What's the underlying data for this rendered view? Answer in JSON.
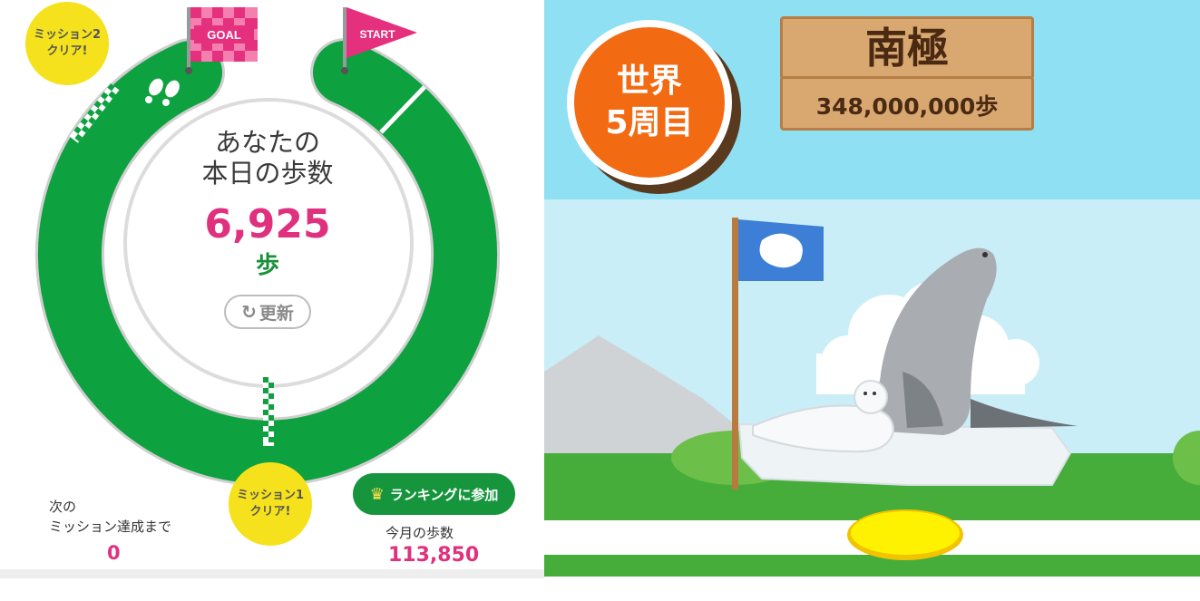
{
  "today": {
    "title_line1": "あなたの",
    "title_line2": "本日の歩数",
    "steps": "6,925",
    "unit": "歩"
  },
  "refresh_button": {
    "label": "更新",
    "icon": "refresh-icon"
  },
  "course": {
    "start_flag": "START",
    "goal_flag": "GOAL",
    "colors": {
      "track": "#0ea13f",
      "start_flag": "#e5307e",
      "goal_flag": "#e5307e"
    }
  },
  "missions": {
    "mission2": {
      "line1": "ミッション2",
      "line2": "クリア!"
    },
    "mission1": {
      "line1": "ミッション1",
      "line2": "クリア!"
    }
  },
  "next_mission": {
    "label_line1": "次の",
    "label_line2": "ミッション達成まで",
    "value": "0"
  },
  "ranking_button": {
    "label": "ランキングに参加",
    "icon": "crown-icon"
  },
  "monthly": {
    "label": "今月の歩数",
    "value": "113,850"
  },
  "world": {
    "line1": "世界",
    "line2": "5周目"
  },
  "location": {
    "name": "南極",
    "distance": "348,000,000歩"
  },
  "accent_colors": {
    "pink": "#e0317f",
    "green": "#16953d",
    "orange": "#f26b12",
    "yellow": "#f5e21d"
  }
}
